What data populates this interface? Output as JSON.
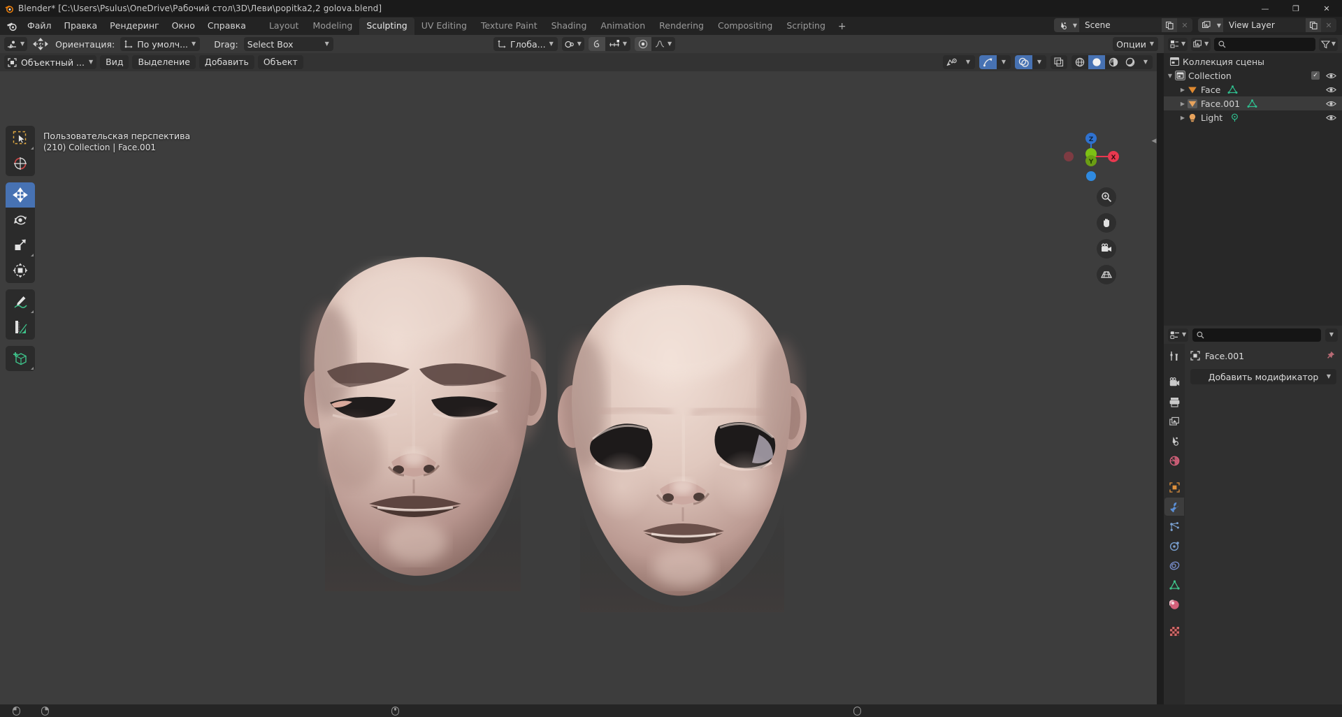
{
  "window": {
    "title": "Blender* [C:\\Users\\Psulus\\OneDrive\\Рабочий стол\\3D\\Леви\\popitka2,2 golova.blend]",
    "minimize": "—",
    "maximize": "❐",
    "close": "✕"
  },
  "menus": [
    {
      "label": "Файл"
    },
    {
      "label": "Правка"
    },
    {
      "label": "Рендеринг"
    },
    {
      "label": "Окно"
    },
    {
      "label": "Справка"
    }
  ],
  "workspaces": {
    "tabs": [
      {
        "label": "Layout",
        "active": false
      },
      {
        "label": "Modeling",
        "active": false
      },
      {
        "label": "Sculpting",
        "active": true
      },
      {
        "label": "UV Editing",
        "active": false
      },
      {
        "label": "Texture Paint",
        "active": false
      },
      {
        "label": "Shading",
        "active": false
      },
      {
        "label": "Animation",
        "active": false
      },
      {
        "label": "Rendering",
        "active": false
      },
      {
        "label": "Compositing",
        "active": false
      },
      {
        "label": "Scripting",
        "active": false
      }
    ],
    "add_label": "+"
  },
  "scene_selector": {
    "name": "Scene",
    "new_label": "❐",
    "unlink_label": "✕"
  },
  "view_layer_selector": {
    "name": "View Layer",
    "new_label": "❐",
    "unlink_label": "✕"
  },
  "tool_settings": {
    "orientation_label": "Ориентация:",
    "orientation_value": "По умолч...",
    "drag_label": "Drag:",
    "drag_value": "Select Box",
    "transform_space": "Глоба...",
    "options_label": "Опции"
  },
  "viewport_header": {
    "mode": "Объектный ...",
    "menus": [
      {
        "label": "Вид"
      },
      {
        "label": "Выделение"
      },
      {
        "label": "Добавить"
      },
      {
        "label": "Объект"
      }
    ]
  },
  "viewport": {
    "perspective_text": "Пользовательская перспектива",
    "scene_info_text": "(210) Collection | Face.001",
    "background_color": "#3d3d3d",
    "gizmo_axes": [
      {
        "label": "Z",
        "color": "#2f72d0"
      },
      {
        "label": "Y",
        "color": "#7dc014"
      },
      {
        "label": "X",
        "color": "#e8384f"
      }
    ],
    "tools": [
      {
        "name": "tweak-tool",
        "active": false
      },
      {
        "name": "cursor-tool",
        "active": false
      },
      {
        "name": "move-tool",
        "active": true
      },
      {
        "name": "rotate-tool",
        "active": false
      },
      {
        "name": "scale-tool",
        "active": false
      },
      {
        "name": "transform-tool",
        "active": false
      },
      {
        "name": "annotate-tool",
        "active": false
      },
      {
        "name": "measure-tool",
        "active": false
      },
      {
        "name": "add-cube-tool",
        "active": false
      }
    ],
    "nav_buttons": [
      {
        "name": "zoom-icon"
      },
      {
        "name": "hand-pan-icon"
      },
      {
        "name": "camera-icon"
      },
      {
        "name": "grid-ortho-icon"
      }
    ]
  },
  "outliner": {
    "display_mode": "view-layer-icon",
    "search_placeholder": "",
    "filter_label": "",
    "root": "Коллекция сцены",
    "items": [
      {
        "name": "Collection",
        "type": "collection",
        "indent": 0,
        "expanded": true,
        "checkbox": true,
        "visible": true,
        "data_icon": null,
        "selected": false
      },
      {
        "name": "Face",
        "type": "mesh",
        "indent": 1,
        "expanded": false,
        "checkbox": false,
        "visible": true,
        "data_icon": "mesh-data",
        "selected": false
      },
      {
        "name": "Face.001",
        "type": "mesh",
        "indent": 1,
        "expanded": false,
        "checkbox": false,
        "visible": true,
        "data_icon": "mesh-data",
        "selected": true
      },
      {
        "name": "Light",
        "type": "light",
        "indent": 1,
        "expanded": false,
        "checkbox": false,
        "visible": true,
        "data_icon": "light-data",
        "selected": false
      }
    ]
  },
  "properties": {
    "search_placeholder": "",
    "breadcrumb_object": "Face.001",
    "add_modifier_label": "Добавить модификатор",
    "tabs": [
      {
        "name": "tool-tab",
        "active": false,
        "color": "#c9c9c9"
      },
      {
        "name": "render-tab",
        "active": false,
        "color": "#c9c9c9"
      },
      {
        "name": "output-tab",
        "active": false,
        "color": "#c9c9c9"
      },
      {
        "name": "view-layer-tab",
        "active": false,
        "color": "#c9c9c9"
      },
      {
        "name": "scene-tab",
        "active": false,
        "color": "#c9c9c9"
      },
      {
        "name": "world-tab",
        "active": false,
        "color": "#d4607a"
      },
      {
        "name": "object-tab",
        "active": false,
        "color": "#e0913c"
      },
      {
        "name": "modifier-tab",
        "active": true,
        "color": "#5b8fd6"
      },
      {
        "name": "particles-tab",
        "active": false,
        "color": "#7aa0d0"
      },
      {
        "name": "physics-tab",
        "active": false,
        "color": "#7aa0d0"
      },
      {
        "name": "constraints-tab",
        "active": false,
        "color": "#7a8fd0"
      },
      {
        "name": "object-data-tab",
        "active": false,
        "color": "#3fc48b"
      },
      {
        "name": "material-tab",
        "active": false,
        "color": "#d4607a"
      },
      {
        "name": "texture-tab",
        "active": false,
        "color": "#d46a6a"
      }
    ]
  },
  "statusbar": {
    "items": [
      {
        "icon": "mouse-left-icon",
        "label": ""
      },
      {
        "icon": "mouse-right-icon",
        "label": ""
      },
      {
        "icon": "mouse-middle-icon",
        "label": ""
      },
      {
        "icon": "mouse-icon",
        "label": ""
      }
    ]
  },
  "colors": {
    "accent_blue": "#4772b3",
    "viewport_bg": "#3d3d3d",
    "panel_bg": "#303030",
    "header_bg": "#232323",
    "skin_light": "#e4cfc6",
    "skin_mid": "#c9aba2",
    "skin_dark": "#8d7068"
  }
}
